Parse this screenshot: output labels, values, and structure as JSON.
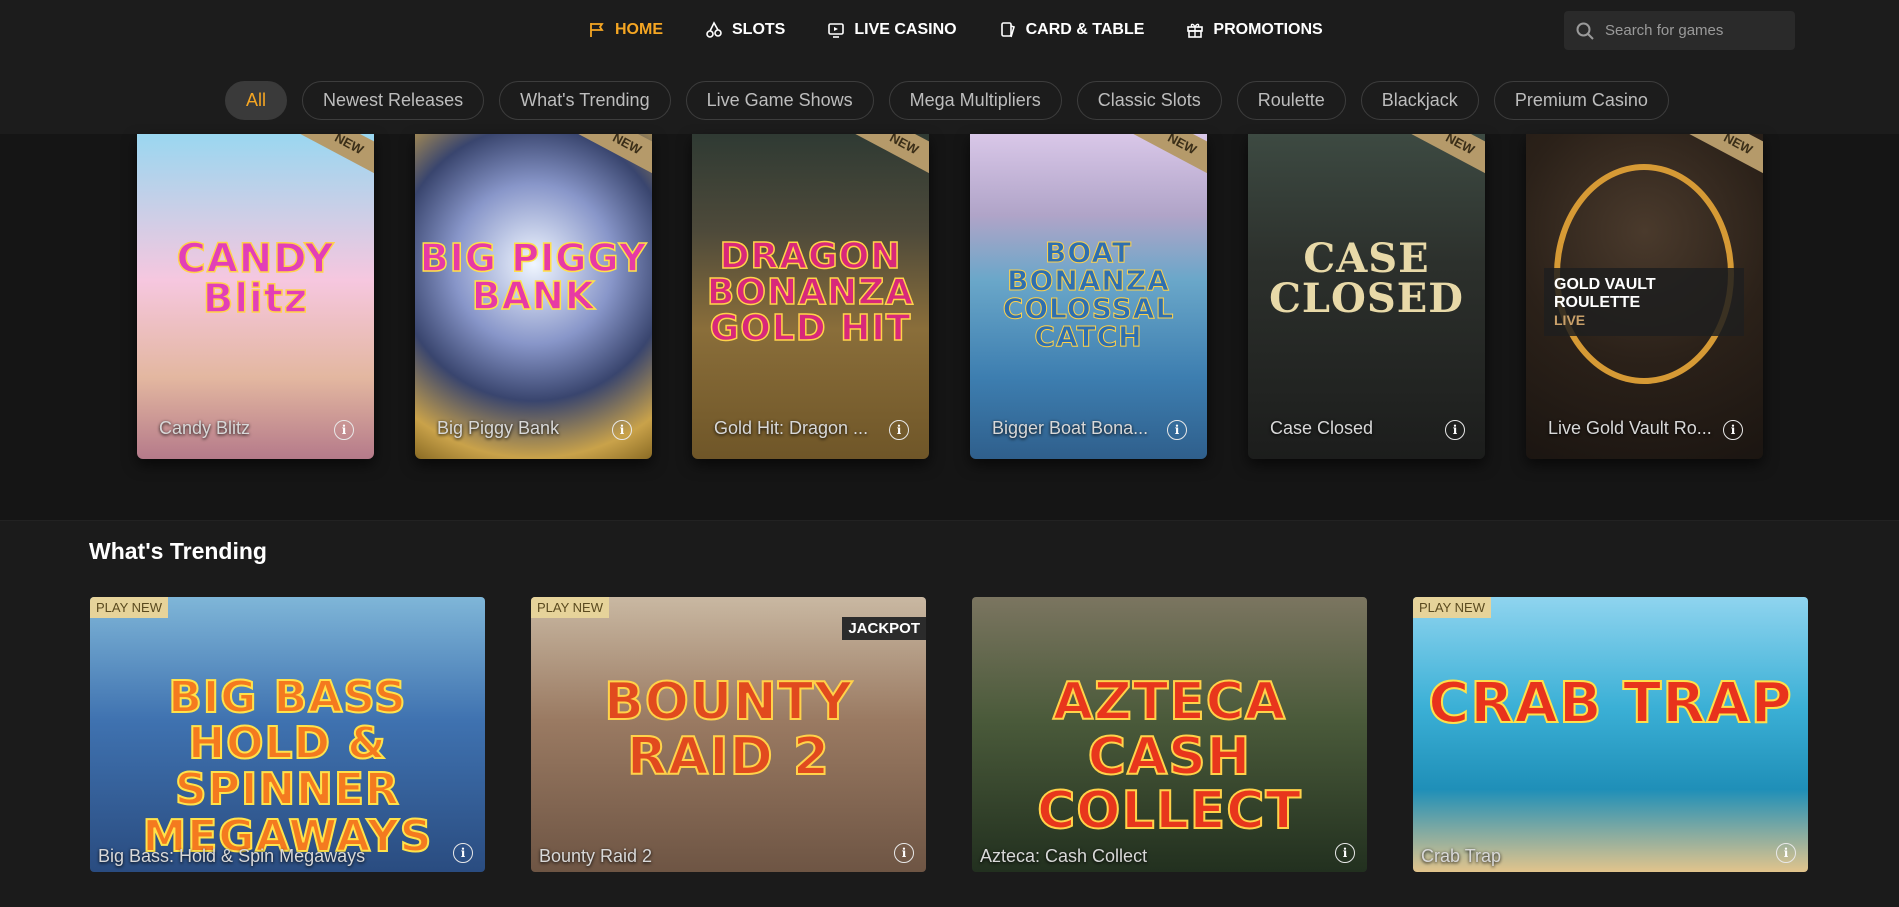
{
  "nav": {
    "items": [
      {
        "label": "HOME",
        "icon": "flag-icon",
        "active": true
      },
      {
        "label": "SLOTS",
        "icon": "cherries-icon",
        "active": false
      },
      {
        "label": "LIVE CASINO",
        "icon": "tv-icon",
        "active": false
      },
      {
        "label": "CARD & TABLE",
        "icon": "cards-icon",
        "active": false
      },
      {
        "label": "PROMOTIONS",
        "icon": "gift-icon",
        "active": false
      }
    ]
  },
  "search": {
    "placeholder": "Search for games",
    "icon": "search-icon"
  },
  "filters": [
    "All",
    "Newest Releases",
    "What's Trending",
    "Live Game Shows",
    "Mega Multipliers",
    "Classic Slots",
    "Roulette",
    "Blackjack",
    "Premium Casino"
  ],
  "newest": {
    "ribbon": "NEW",
    "games": [
      {
        "caption": "Candy Blitz",
        "logo": "CANDY Blitz"
      },
      {
        "caption": "Big Piggy Bank",
        "logo": "BIG PIGGY BANK"
      },
      {
        "caption": "Gold Hit: Dragon ...",
        "logo": "DRAGON BONANZA GOLD HIT"
      },
      {
        "caption": "Bigger Boat Bona...",
        "logo": "BOAT BONANZA COLOSSAL CATCH"
      },
      {
        "caption": "Case Closed",
        "logo": "CASE CLOSED"
      },
      {
        "caption": "Live Gold Vault Ro...",
        "logo": "",
        "live_title": "GOLD VAULT ROULETTE",
        "live_sub": "LIVE"
      }
    ]
  },
  "trending": {
    "title": "What's Trending",
    "badge": "PLAY NEW",
    "jackpot": "JACKPOT",
    "games": [
      {
        "caption": "Big Bass: Hold & Spin Megaways",
        "logo": "BIG BASS HOLD & SPINNER MEGAWAYS"
      },
      {
        "caption": "Bounty Raid 2",
        "logo": "BOUNTY RAID 2"
      },
      {
        "caption": "Azteca: Cash Collect",
        "logo": "AZTECA CASH COLLECT"
      },
      {
        "caption": "Crab Trap",
        "logo": "CRAB TRAP"
      }
    ]
  },
  "colors": {
    "accent": "#f5a623",
    "background": "#191919"
  }
}
